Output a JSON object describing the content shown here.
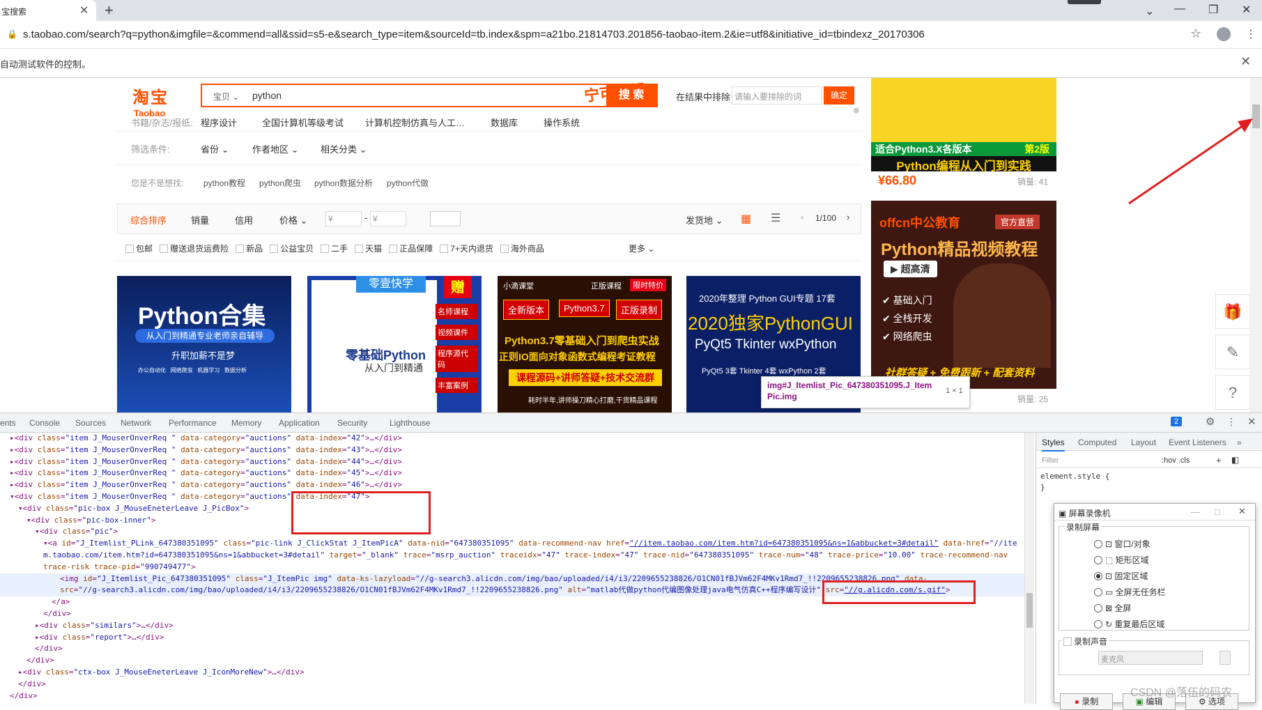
{
  "browser": {
    "tab_title": "宝搜索",
    "url": "s.taobao.com/search?q=python&imgfile=&commend=all&ssid=s5-e&search_type=item&sourceId=tb.index&spm=a21bo.21814703.201856-taobao-item.2&ie=utf8&initiative_id=tbindexz_20170306",
    "automation_notice": "自动测试软件的控制。"
  },
  "header": {
    "logo_cn": "淘宝",
    "logo_en": "Taobao",
    "search_category": "宝贝",
    "search_value": "python",
    "search_button": "搜 索",
    "overlay_text": "宁可远望",
    "exclude_label": "在结果中排除",
    "exclude_placeholder": "请输入要排除的词",
    "exclude_button": "确定"
  },
  "filters": {
    "row1_label": "书籍/杂志/报纸:",
    "row1_items": [
      "程序设计",
      "全国计算机等级考试",
      "计算机控制仿真与人工…",
      "数据库",
      "操作系统"
    ],
    "row2_label": "筛选条件:",
    "row2_items": [
      "省份",
      "作者地区",
      "相关分类"
    ],
    "suggest_label": "您是不是想找:",
    "suggest_items": [
      "python教程",
      "python爬虫",
      "python数据分析",
      "python代做"
    ]
  },
  "sortbar": {
    "items": [
      "综合排序",
      "销量",
      "信用",
      "价格"
    ],
    "price_from": "¥",
    "price_to": "¥",
    "ship_from": "发货地",
    "page": "1/100"
  },
  "checks": [
    "包邮",
    "赠送退货运费险",
    "新品",
    "公益宝贝",
    "二手",
    "天猫",
    "正品保障",
    "7+天内退货",
    "海外商品"
  ],
  "more": "更多",
  "products": [
    {
      "title": "Python合集",
      "sub": "从入门到精通专业老师亲自辅导",
      "sub2": "升职加薪不是梦",
      "tags": [
        "办公自动化",
        "网络爬虫",
        "机器学习",
        "数据分析"
      ]
    },
    {
      "title": "零基础Python",
      "sub": "从入门到精通",
      "tag1": "零壹快学",
      "tag2": "赠",
      "side": [
        "名师课程",
        "视频课件",
        "程序源代码",
        "丰富案例"
      ]
    },
    {
      "title": "Python3.7零基础入门到爬虫实战",
      "sub": "正则IO面向对象函数式编程考证教程",
      "top": "小滴课堂",
      "badge1": "正版课程",
      "badge2": "限时特价",
      "btns": [
        "全新版本",
        "Python3.7",
        "正版录制"
      ],
      "band": "课程源码+讲师答疑+技术交流群",
      "foot": "耗时半年,讲师操刀精心打磨,干货精品课程"
    },
    {
      "title": "2020独家PythonGUI",
      "sub": "PyQt5 Tkinter wxPython",
      "top": "2020年整理 Python GUI专题 17套",
      "line": "PyQt5 3套 Tkinter 4套 wxPython 2套"
    }
  ],
  "ads": {
    "ad1_title": "Python编程从入门到实践",
    "ad1_sub": "适合Python3.X各版本",
    "ad1_edition": "第2版",
    "ad1_price": "¥66.80",
    "ad1_sales": "销量: 41",
    "ad2_brand": "offcn中公教育",
    "ad2_badge": "官方直营",
    "ad2_title": "Python精品视频教程",
    "ad2_hd": "超高清",
    "ad2_list": [
      "基础入门",
      "全栈开发",
      "网络爬虫"
    ],
    "ad2_foot": "社群答疑 + 免费跟新 + 配套资料",
    "ad2_sales": "销量: 25"
  },
  "tooltip": {
    "text": "img#J_Itemlist_Pic_647380351095.J_ItemPic.img",
    "size": "1 × 1"
  },
  "devtools": {
    "tabs": [
      "ents",
      "Console",
      "Sources",
      "Network",
      "Performance",
      "Memory",
      "Application",
      "Security",
      "Lighthouse"
    ],
    "badge": "2",
    "styles_tabs": [
      "Styles",
      "Computed",
      "Layout",
      "Event Listeners"
    ],
    "filter": "Filter",
    "hov": ":hov .cls",
    "element_style": "element.style {",
    "close_brace": "}"
  },
  "recorder": {
    "title": "屏幕录像机",
    "group1": "录制屏幕",
    "options": [
      "窗口/对象",
      "矩形区域",
      "固定区域",
      "全屏无任务栏",
      "全屏",
      "重复最后区域"
    ],
    "selected": 2,
    "group2": "录制声音",
    "mic": "麦克风",
    "btn1": "录制",
    "btn2": "编辑",
    "btn3": "选项"
  },
  "watermark": "CSDN @落伍的码农"
}
